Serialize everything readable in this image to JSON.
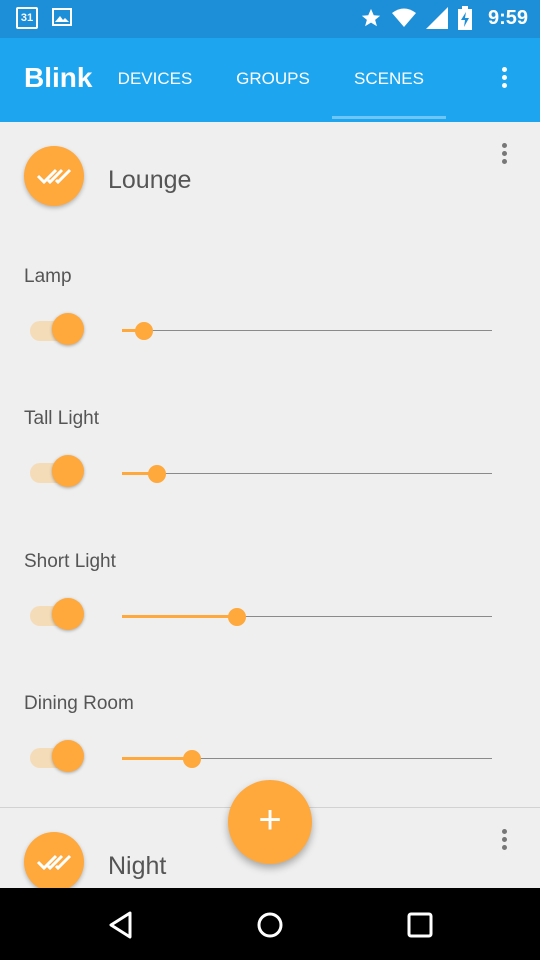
{
  "status_bar": {
    "calendar_day": "31",
    "time": "9:59",
    "icons": [
      "calendar-icon",
      "image-icon",
      "star-icon",
      "wifi-icon",
      "signal-icon",
      "battery-charging-icon"
    ]
  },
  "app_bar": {
    "title": "Blink",
    "tabs": [
      {
        "label": "DEVICES",
        "selected": false
      },
      {
        "label": "GROUPS",
        "selected": false
      },
      {
        "label": "SCENES",
        "selected": true
      }
    ]
  },
  "scenes": [
    {
      "name": "Lounge",
      "devices": [
        {
          "label": "Lamp",
          "on": true,
          "level": 0.06
        },
        {
          "label": "Tall Light",
          "on": true,
          "level": 0.095
        },
        {
          "label": "Short Light",
          "on": true,
          "level": 0.31
        },
        {
          "label": "Dining Room",
          "on": true,
          "level": 0.19
        }
      ]
    },
    {
      "name": "Night",
      "devices": []
    }
  ],
  "fab": {
    "label": "+"
  },
  "colors": {
    "status_bar": "#1d8ed8",
    "app_bar": "#1ea5ef",
    "accent": "#ffa83c",
    "background": "#efefef"
  }
}
